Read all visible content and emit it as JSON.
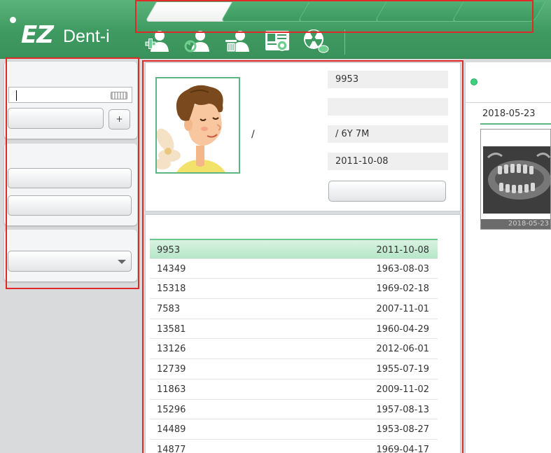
{
  "app": {
    "logo_main": "EZ",
    "logo_sub": "Dent-i"
  },
  "toolbar": {
    "icons": [
      "add-patient-icon",
      "sync-patient-icon",
      "delete-patient-icon",
      "patient-card-icon",
      "radiation-icon"
    ]
  },
  "patient": {
    "id": "9953",
    "name": "",
    "age": " / 6Y 7M",
    "birthdate": "2011-10-08",
    "gender_separator": "/"
  },
  "patient_list": [
    {
      "id": "9953",
      "date": "2011-10-08",
      "selected": true
    },
    {
      "id": "14349",
      "date": "1963-08-03"
    },
    {
      "id": "15318",
      "date": "1969-02-18"
    },
    {
      "id": "7583",
      "date": "2007-11-01"
    },
    {
      "id": "13581",
      "date": "1960-04-29"
    },
    {
      "id": "13126",
      "date": "2012-06-01"
    },
    {
      "id": "12739",
      "date": "1955-07-19"
    },
    {
      "id": "11863",
      "date": "2009-11-02"
    },
    {
      "id": "15296",
      "date": "1957-08-13"
    },
    {
      "id": "14489",
      "date": "1953-08-27"
    },
    {
      "id": "14877",
      "date": "1969-04-17"
    }
  ],
  "imaging": {
    "date": "2018-05-23",
    "thumb_caption": "2018-05-23"
  },
  "search": {
    "add_label": "+"
  },
  "colors": {
    "brand_green": "#3e9a60",
    "selection": "#b6e6c8",
    "highlight_outline": "#e02a2a"
  }
}
